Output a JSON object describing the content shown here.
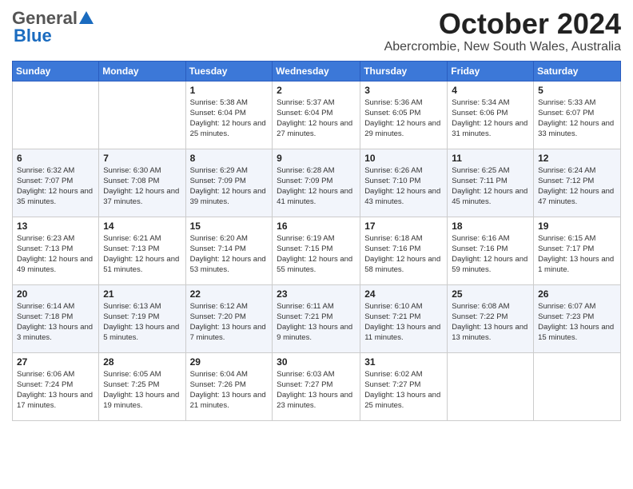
{
  "logo": {
    "general": "General",
    "blue": "Blue"
  },
  "title": "October 2024",
  "location": "Abercrombie, New South Wales, Australia",
  "days_of_week": [
    "Sunday",
    "Monday",
    "Tuesday",
    "Wednesday",
    "Thursday",
    "Friday",
    "Saturday"
  ],
  "weeks": [
    [
      {
        "day": "",
        "sunrise": "",
        "sunset": "",
        "daylight": ""
      },
      {
        "day": "",
        "sunrise": "",
        "sunset": "",
        "daylight": ""
      },
      {
        "day": "1",
        "sunrise": "Sunrise: 5:38 AM",
        "sunset": "Sunset: 6:04 PM",
        "daylight": "Daylight: 12 hours and 25 minutes."
      },
      {
        "day": "2",
        "sunrise": "Sunrise: 5:37 AM",
        "sunset": "Sunset: 6:04 PM",
        "daylight": "Daylight: 12 hours and 27 minutes."
      },
      {
        "day": "3",
        "sunrise": "Sunrise: 5:36 AM",
        "sunset": "Sunset: 6:05 PM",
        "daylight": "Daylight: 12 hours and 29 minutes."
      },
      {
        "day": "4",
        "sunrise": "Sunrise: 5:34 AM",
        "sunset": "Sunset: 6:06 PM",
        "daylight": "Daylight: 12 hours and 31 minutes."
      },
      {
        "day": "5",
        "sunrise": "Sunrise: 5:33 AM",
        "sunset": "Sunset: 6:07 PM",
        "daylight": "Daylight: 12 hours and 33 minutes."
      }
    ],
    [
      {
        "day": "6",
        "sunrise": "Sunrise: 6:32 AM",
        "sunset": "Sunset: 7:07 PM",
        "daylight": "Daylight: 12 hours and 35 minutes."
      },
      {
        "day": "7",
        "sunrise": "Sunrise: 6:30 AM",
        "sunset": "Sunset: 7:08 PM",
        "daylight": "Daylight: 12 hours and 37 minutes."
      },
      {
        "day": "8",
        "sunrise": "Sunrise: 6:29 AM",
        "sunset": "Sunset: 7:09 PM",
        "daylight": "Daylight: 12 hours and 39 minutes."
      },
      {
        "day": "9",
        "sunrise": "Sunrise: 6:28 AM",
        "sunset": "Sunset: 7:09 PM",
        "daylight": "Daylight: 12 hours and 41 minutes."
      },
      {
        "day": "10",
        "sunrise": "Sunrise: 6:26 AM",
        "sunset": "Sunset: 7:10 PM",
        "daylight": "Daylight: 12 hours and 43 minutes."
      },
      {
        "day": "11",
        "sunrise": "Sunrise: 6:25 AM",
        "sunset": "Sunset: 7:11 PM",
        "daylight": "Daylight: 12 hours and 45 minutes."
      },
      {
        "day": "12",
        "sunrise": "Sunrise: 6:24 AM",
        "sunset": "Sunset: 7:12 PM",
        "daylight": "Daylight: 12 hours and 47 minutes."
      }
    ],
    [
      {
        "day": "13",
        "sunrise": "Sunrise: 6:23 AM",
        "sunset": "Sunset: 7:13 PM",
        "daylight": "Daylight: 12 hours and 49 minutes."
      },
      {
        "day": "14",
        "sunrise": "Sunrise: 6:21 AM",
        "sunset": "Sunset: 7:13 PM",
        "daylight": "Daylight: 12 hours and 51 minutes."
      },
      {
        "day": "15",
        "sunrise": "Sunrise: 6:20 AM",
        "sunset": "Sunset: 7:14 PM",
        "daylight": "Daylight: 12 hours and 53 minutes."
      },
      {
        "day": "16",
        "sunrise": "Sunrise: 6:19 AM",
        "sunset": "Sunset: 7:15 PM",
        "daylight": "Daylight: 12 hours and 55 minutes."
      },
      {
        "day": "17",
        "sunrise": "Sunrise: 6:18 AM",
        "sunset": "Sunset: 7:16 PM",
        "daylight": "Daylight: 12 hours and 58 minutes."
      },
      {
        "day": "18",
        "sunrise": "Sunrise: 6:16 AM",
        "sunset": "Sunset: 7:16 PM",
        "daylight": "Daylight: 12 hours and 59 minutes."
      },
      {
        "day": "19",
        "sunrise": "Sunrise: 6:15 AM",
        "sunset": "Sunset: 7:17 PM",
        "daylight": "Daylight: 13 hours and 1 minute."
      }
    ],
    [
      {
        "day": "20",
        "sunrise": "Sunrise: 6:14 AM",
        "sunset": "Sunset: 7:18 PM",
        "daylight": "Daylight: 13 hours and 3 minutes."
      },
      {
        "day": "21",
        "sunrise": "Sunrise: 6:13 AM",
        "sunset": "Sunset: 7:19 PM",
        "daylight": "Daylight: 13 hours and 5 minutes."
      },
      {
        "day": "22",
        "sunrise": "Sunrise: 6:12 AM",
        "sunset": "Sunset: 7:20 PM",
        "daylight": "Daylight: 13 hours and 7 minutes."
      },
      {
        "day": "23",
        "sunrise": "Sunrise: 6:11 AM",
        "sunset": "Sunset: 7:21 PM",
        "daylight": "Daylight: 13 hours and 9 minutes."
      },
      {
        "day": "24",
        "sunrise": "Sunrise: 6:10 AM",
        "sunset": "Sunset: 7:21 PM",
        "daylight": "Daylight: 13 hours and 11 minutes."
      },
      {
        "day": "25",
        "sunrise": "Sunrise: 6:08 AM",
        "sunset": "Sunset: 7:22 PM",
        "daylight": "Daylight: 13 hours and 13 minutes."
      },
      {
        "day": "26",
        "sunrise": "Sunrise: 6:07 AM",
        "sunset": "Sunset: 7:23 PM",
        "daylight": "Daylight: 13 hours and 15 minutes."
      }
    ],
    [
      {
        "day": "27",
        "sunrise": "Sunrise: 6:06 AM",
        "sunset": "Sunset: 7:24 PM",
        "daylight": "Daylight: 13 hours and 17 minutes."
      },
      {
        "day": "28",
        "sunrise": "Sunrise: 6:05 AM",
        "sunset": "Sunset: 7:25 PM",
        "daylight": "Daylight: 13 hours and 19 minutes."
      },
      {
        "day": "29",
        "sunrise": "Sunrise: 6:04 AM",
        "sunset": "Sunset: 7:26 PM",
        "daylight": "Daylight: 13 hours and 21 minutes."
      },
      {
        "day": "30",
        "sunrise": "Sunrise: 6:03 AM",
        "sunset": "Sunset: 7:27 PM",
        "daylight": "Daylight: 13 hours and 23 minutes."
      },
      {
        "day": "31",
        "sunrise": "Sunrise: 6:02 AM",
        "sunset": "Sunset: 7:27 PM",
        "daylight": "Daylight: 13 hours and 25 minutes."
      },
      {
        "day": "",
        "sunrise": "",
        "sunset": "",
        "daylight": ""
      },
      {
        "day": "",
        "sunrise": "",
        "sunset": "",
        "daylight": ""
      }
    ]
  ]
}
